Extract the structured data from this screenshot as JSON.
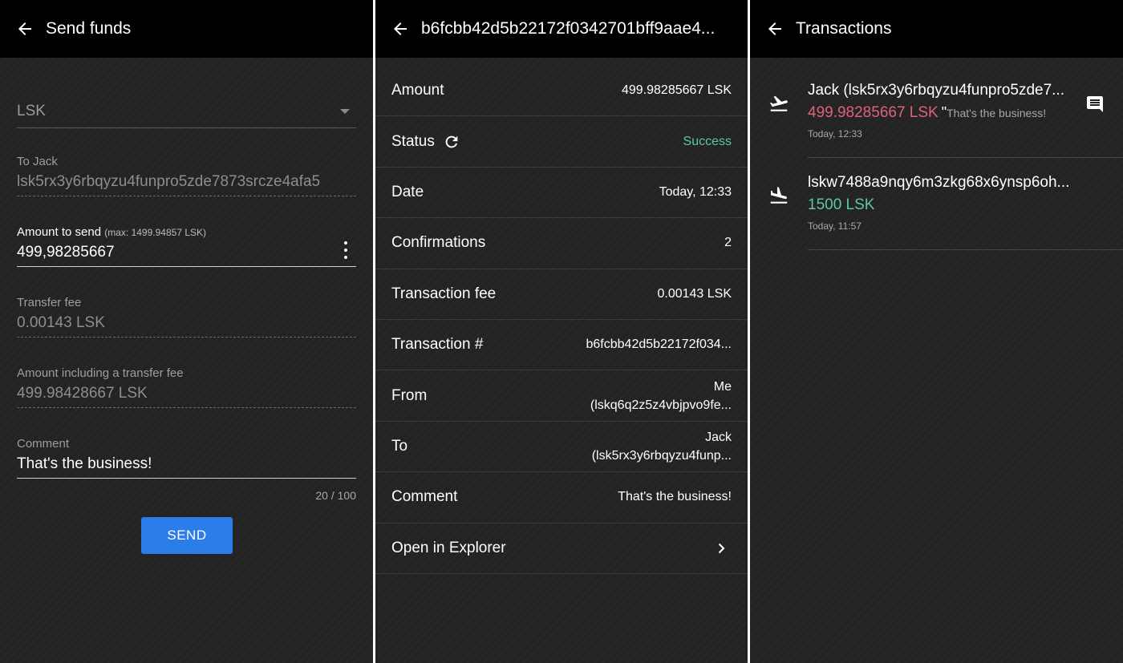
{
  "send": {
    "title": "Send funds",
    "currency": "LSK",
    "to_label": "To Jack",
    "to_address": "lsk5rx3y6rbqyzu4funpro5zde7873srcze4afa5",
    "amount_label": "Amount to send",
    "amount_max": "(max: 1499.94857 LSK)",
    "amount_value": "499,98285667",
    "fee_label": "Transfer fee",
    "fee_value": "0.00143 LSK",
    "total_label": "Amount including a transfer fee",
    "total_value": "499.98428667 LSK",
    "comment_label": "Comment",
    "comment_value": "That's the business!",
    "counter": "20 / 100",
    "send_button": "SEND"
  },
  "details": {
    "title": "b6fcbb42d5b22172f0342701bff9aae4...",
    "rows": [
      {
        "key": "Amount",
        "value": "499.98285667 LSK"
      },
      {
        "key": "Status",
        "value": "Success"
      },
      {
        "key": "Date",
        "value": "Today, 12:33"
      },
      {
        "key": "Confirmations",
        "value": "2"
      },
      {
        "key": "Transaction fee",
        "value": "0.00143 LSK"
      },
      {
        "key": "Transaction #",
        "value": "b6fcbb42d5b22172f034..."
      },
      {
        "key": "From",
        "value_line1": "Me",
        "value_line2": "(lskq6q2z5z4vbjpvo9fe..."
      },
      {
        "key": "To",
        "value_line1": "Jack",
        "value_line2": "(lsk5rx3y6rbqyzu4funp..."
      },
      {
        "key": "Comment",
        "value": "That's the business!"
      },
      {
        "key": "Open in Explorer"
      }
    ]
  },
  "transactions": {
    "title": "Transactions",
    "items": [
      {
        "name": "Jack (lsk5rx3y6rbqyzu4funpro5zde7...",
        "amount": "499.98285667 LSK",
        "comment": "That's the business!",
        "time": "Today, 12:33",
        "direction_icon": "flight-takeoff-icon"
      },
      {
        "name": "lskw7488a9nqy6m3zkg68x6ynsp6oh...",
        "amount": "1500 LSK",
        "time": "Today, 11:57",
        "direction_icon": "flight-land-icon"
      }
    ]
  },
  "colors": {
    "accent": "#2b7de9",
    "success": "#5cc9a1",
    "outgoing": "#e0617a",
    "background": "#232323",
    "topbar": "#000000"
  }
}
